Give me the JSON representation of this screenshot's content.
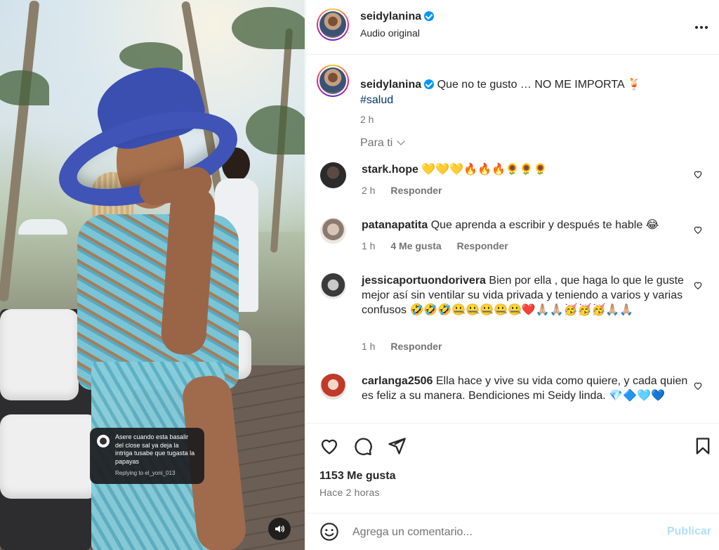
{
  "header": {
    "username": "seidylanina",
    "audio": "Audio original",
    "more_icon": "more-horizontal-icon"
  },
  "media": {
    "reply_sticker": {
      "message": "Asere cuando esta basalir del close sal ya deja la intriga tusabe que tugasta la papayas",
      "replying_to": "Replying to el_yoni_013"
    },
    "audio_icon": "speaker-icon"
  },
  "caption": {
    "username": "seidylanina",
    "text": "Que no te gusto … NO ME IMPORTA 🍹",
    "hashtag": "#salud",
    "time": "2 h"
  },
  "filter": {
    "label": "Para ti"
  },
  "comments": [
    {
      "username": "stark.hope",
      "text": "💛💛💛🔥🔥🔥🌻🌻🌻",
      "time": "2 h",
      "likes": "",
      "reply": "Responder",
      "avatar_color": "#2b2b2b"
    },
    {
      "username": "patanapatita",
      "text": "Que aprenda a escribir y después te hable 😂",
      "time": "1 h",
      "likes": "4 Me gusta",
      "reply": "Responder",
      "avatar_color": "#c9b8ae"
    },
    {
      "username": "jessicaportuondorivera",
      "text": "Bien por ella , que haga lo que le guste mejor así sin ventilar su vida privada y teniendo a varios y varias confusos 🤣🤣🤣🤐🤐🤐🤐🤐❤️🙏🏼🙏🏼🥳🥳🥳🙏🏼🙏🏼",
      "time": "1 h",
      "likes": "",
      "reply": "Responder",
      "avatar_color": "#3a3a3a"
    },
    {
      "username": "carlanga2506",
      "text": "Ella hace y vive su vida como quiere, y cada quien es feliz a su manera. Bendiciones mi Seidy linda. 💎🔷🩵💙",
      "time": "",
      "likes": "",
      "reply": "",
      "avatar_color": "#c0392b"
    }
  ],
  "actions": {
    "like_icon": "heart-icon",
    "comment_icon": "comment-icon",
    "share_icon": "send-icon",
    "save_icon": "bookmark-icon",
    "likes": "1153 Me gusta",
    "ago": "Hace 2 horas"
  },
  "add_comment": {
    "placeholder": "Agrega un comentario...",
    "post_label": "Publicar",
    "emoji_icon": "emoji-icon"
  },
  "colors": {
    "link": "#00376b",
    "verified": "#0095f6",
    "muted": "#737373",
    "post_disabled": "#b2dffc"
  }
}
